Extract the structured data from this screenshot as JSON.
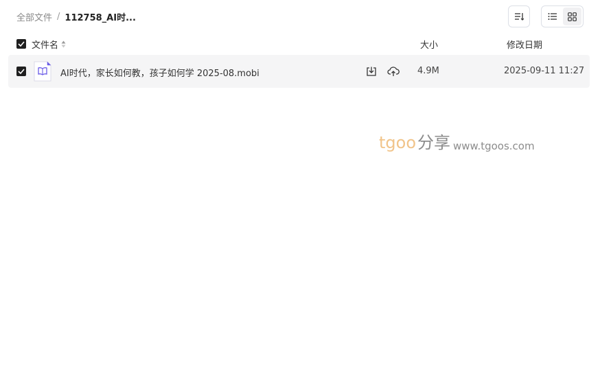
{
  "breadcrumb": {
    "root": "全部文件",
    "separator": "/",
    "current": "112758_AI时..."
  },
  "toolbar": {
    "sort_icon": "sort-list-icon",
    "view_list_icon": "list-view-icon",
    "view_grid_icon": "grid-view-icon",
    "active_view": "grid"
  },
  "columns": {
    "name": "文件名",
    "size": "大小",
    "modified": "修改日期"
  },
  "files": [
    {
      "name": "AI时代，家长如何教，孩子如何学 2025-08.mobi",
      "size": "4.9M",
      "modified": "2025-09-11 11:27",
      "checked": true,
      "icon": "ebook-file-icon"
    }
  ],
  "select_all_checked": true,
  "watermark": {
    "brand": "tgoo",
    "share": "分享",
    "url": "www.tgoos.com"
  },
  "colors": {
    "checkbox": "#1f1f1f",
    "row_background": "#f5f5f6",
    "file_icon_accent": "#6b5ce7",
    "watermark_brand": "#f1c48a"
  }
}
